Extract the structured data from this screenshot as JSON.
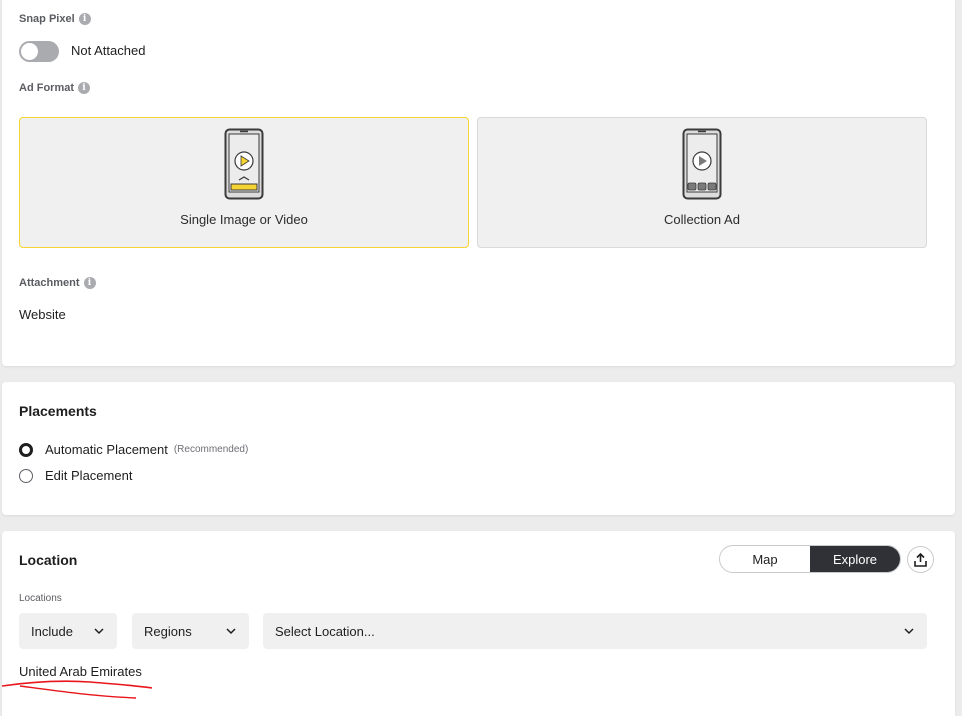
{
  "snap_pixel": {
    "label": "Snap Pixel",
    "status": "Not Attached"
  },
  "ad_format": {
    "label": "Ad Format",
    "options": [
      {
        "label": "Single Image or Video",
        "selected": true
      },
      {
        "label": "Collection Ad",
        "selected": false
      }
    ]
  },
  "attachment": {
    "label": "Attachment",
    "value": "Website"
  },
  "placements": {
    "title": "Placements",
    "options": [
      {
        "label": "Automatic Placement",
        "note": "(Recommended)",
        "checked": true
      },
      {
        "label": "Edit Placement",
        "checked": false
      }
    ]
  },
  "location": {
    "title": "Location",
    "toggle": {
      "map": "Map",
      "explore": "Explore",
      "active": "Explore"
    },
    "locations_label": "Locations",
    "include": "Include",
    "type": "Regions",
    "placeholder": "Select Location...",
    "selected_value": "United Arab Emirates"
  },
  "colors": {
    "accent_yellow": "#f5d332",
    "dark": "#2f3136",
    "annotation_red": "#e8161b"
  }
}
